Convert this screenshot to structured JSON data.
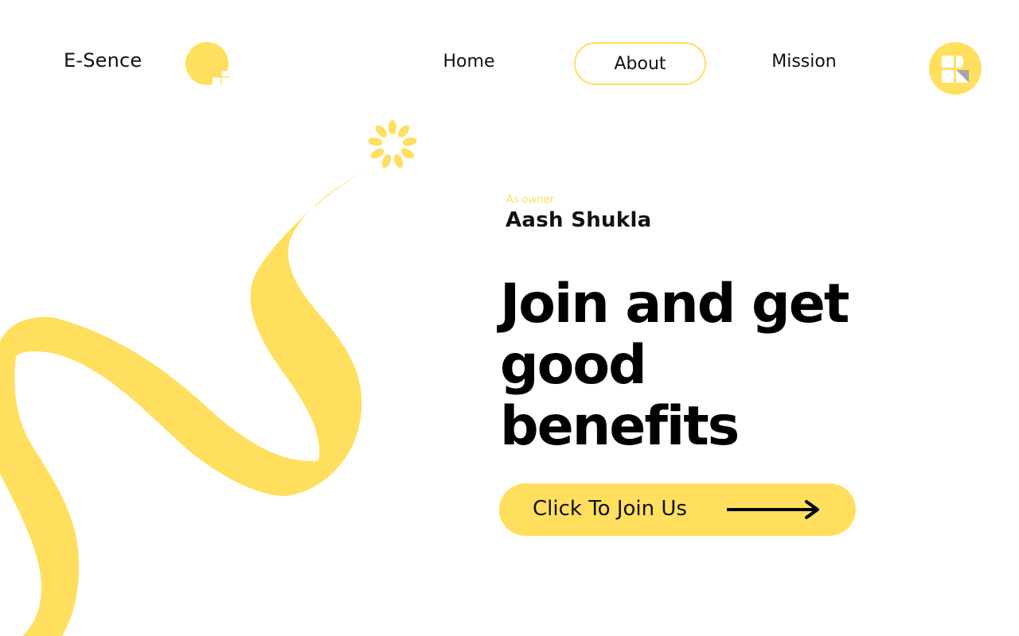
{
  "header": {
    "brand": "E-Sence",
    "nav": [
      {
        "label": "Home",
        "active": false
      },
      {
        "label": "About",
        "active": true
      },
      {
        "label": "Mission",
        "active": false
      }
    ]
  },
  "hero": {
    "owner_label": "As owner",
    "owner_name": "Aash Shukla",
    "headline_lines": [
      "Join and get",
      "good",
      "benefits"
    ],
    "cta_label": "Click To Join Us"
  },
  "icons": {
    "brand_mark": "yellow-circle-logo-icon",
    "profile_button": "grid-logo-icon",
    "cta_arrow": "arrow-right-icon",
    "decoration": "ribbon-flower"
  },
  "colors": {
    "accent": "#ffdf5d",
    "text": "#111111",
    "background": "#ffffff",
    "logo_shade": "#a7a7a7"
  }
}
